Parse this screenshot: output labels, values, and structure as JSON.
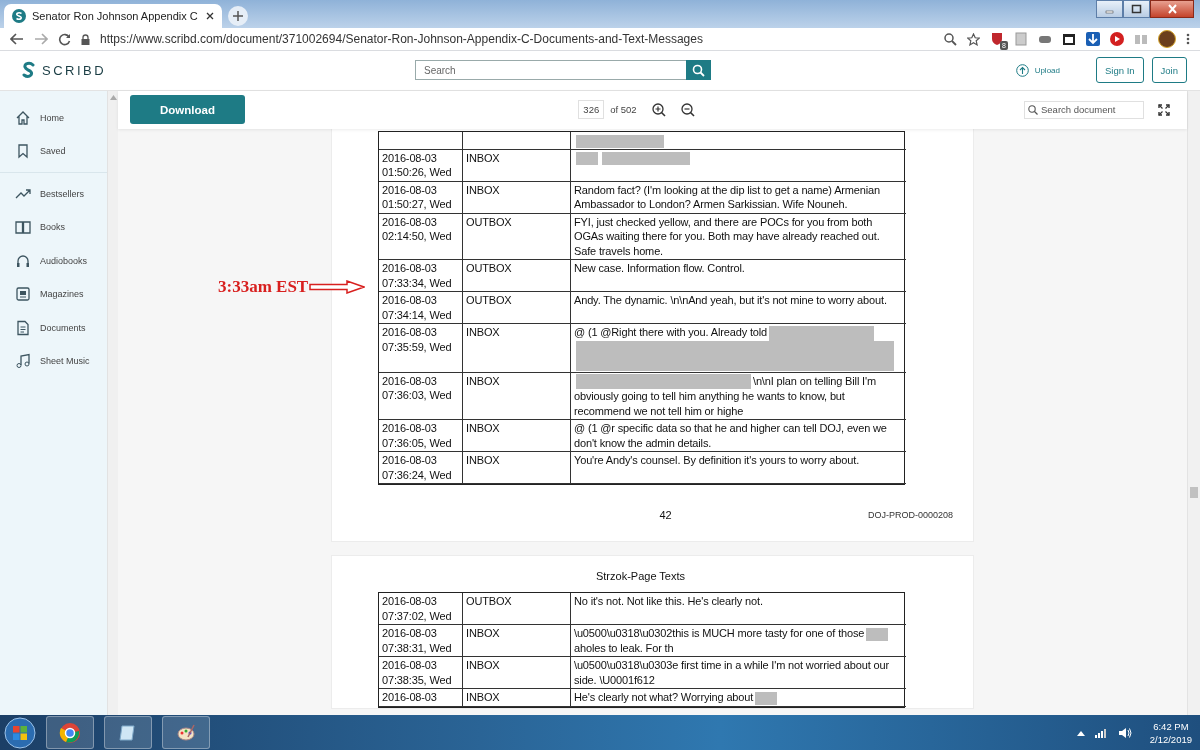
{
  "browser": {
    "tab": {
      "title": "Senator Ron Johnson Appendix C",
      "selected": true
    },
    "url": "https://www.scribd.com/document/371002694/Senator-Ron-Johnson-Appendix-C-Documents-and-Text-Messages",
    "extension_badge": "8"
  },
  "header": {
    "logo": "SCRIBD",
    "search_placeholder": "Search",
    "upload": "Upload",
    "sign_in": "Sign In",
    "join": "Join"
  },
  "sidebar": {
    "sections": [
      {
        "items": [
          {
            "label": "Home"
          },
          {
            "label": "Saved"
          }
        ]
      },
      {
        "items": [
          {
            "label": "Bestsellers"
          },
          {
            "label": "Books"
          },
          {
            "label": "Audiobooks"
          },
          {
            "label": "Magazines"
          },
          {
            "label": "Documents"
          },
          {
            "label": "Sheet Music"
          }
        ]
      }
    ]
  },
  "toolbar": {
    "download": "Download",
    "page": "326",
    "page_total": "of 502",
    "search_placeholder": "Search document"
  },
  "annotation": {
    "text": "3:33am EST"
  },
  "pages": [
    {
      "rows": [
        {
          "segments": [
            {
              "kind": "redaction_long"
            }
          ]
        },
        {
          "date": "2016-08-03",
          "time": "01:50:26, Wed",
          "folder": "INBOX",
          "segments": [
            {
              "kind": "redaction_short"
            },
            {
              "kind": "redaction_long"
            }
          ]
        },
        {
          "date": "2016-08-03",
          "time": "01:50:27, Wed",
          "folder": "INBOX",
          "segments": [
            {
              "kind": "text",
              "text": "Random fact? (I'm looking at the dip list to get a name) Armenian Ambassador to London? Armen Sarkissian. Wife Nouneh."
            }
          ]
        },
        {
          "date": "2016-08-03",
          "time": "02:14:50, Wed",
          "folder": "OUTBOX",
          "segments": [
            {
              "kind": "text",
              "text": "FYI, just checked yellow, and there are POCs for you from both OGAs waiting there for you. Both may have already reached out. Safe travels home."
            }
          ]
        },
        {
          "date": "2016-08-03",
          "time": "07:33:34, Wed",
          "folder": "OUTBOX",
          "segments": [
            {
              "kind": "text",
              "text": "New case. Information flow. Control."
            }
          ]
        },
        {
          "date": "2016-08-03",
          "time": "07:34:14, Wed",
          "folder": "OUTBOX",
          "segments": [
            {
              "kind": "text",
              "text": "Andy. The dynamic. \\n\\nAnd yeah, but it's not mine to worry about."
            }
          ]
        },
        {
          "date": "2016-08-03",
          "time": "07:35:59, Wed",
          "folder": "INBOX",
          "segments": [
            {
              "kind": "text",
              "text": "@ (1 @Right there with you. Already told"
            },
            {
              "kind": "redaction_fill"
            },
            {
              "kind": "redaction_block"
            }
          ]
        },
        {
          "date": "2016-08-03",
          "time": "07:36:03, Wed",
          "folder": "INBOX",
          "segments": [
            {
              "kind": "redaction_wide"
            },
            {
              "kind": "text",
              "text": "\\n\\nI plan on telling Bill I'm"
            },
            {
              "kind": "text",
              "text": "obviously going to tell him anything he wants to know, but recommend we not tell him or highe"
            }
          ]
        },
        {
          "date": "2016-08-03",
          "time": "07:36:05, Wed",
          "folder": "INBOX",
          "segments": [
            {
              "kind": "text",
              "text": "@ (1 @r specific data so that he and higher can tell DOJ, even we don't know the admin details."
            }
          ]
        },
        {
          "date": "2016-08-03",
          "time": "07:36:24, Wed",
          "folder": "INBOX",
          "segments": [
            {
              "kind": "text",
              "text": "You're Andy's counsel. By definition it's yours to worry about."
            }
          ]
        }
      ],
      "page_number": "42",
      "bates": "DOJ-PROD-0000208"
    },
    {
      "title": "Strzok-Page Texts",
      "rows": [
        {
          "date": "2016-08-03",
          "time": "07:37:02, Wed",
          "folder": "OUTBOX",
          "segments": [
            {
              "kind": "text",
              "text": "No it's not. Not like this. He's clearly not."
            }
          ]
        },
        {
          "date": "2016-08-03",
          "time": "07:38:31, Wed",
          "folder": "INBOX",
          "segments": [
            {
              "kind": "text",
              "text": "\\u0500\\u0318\\u0302this is MUCH more tasty for one of those"
            },
            {
              "kind": "redaction_short"
            },
            {
              "kind": "text",
              "text": "aholes to leak. For th"
            }
          ]
        },
        {
          "date": "2016-08-03",
          "time": "07:38:35, Wed",
          "folder": "INBOX",
          "segments": [
            {
              "kind": "text",
              "text": "\\u0500\\u0318\\u0303e first time in a while I'm not worried about our side. \\U0001f612"
            }
          ]
        },
        {
          "date": "2016-08-03",
          "folder": "INBOX",
          "segments": [
            {
              "kind": "text",
              "text": "He's clearly not what? Worrying about"
            },
            {
              "kind": "redaction_short"
            }
          ]
        }
      ]
    }
  ],
  "taskbar": {
    "time": "6:42 PM",
    "date": "2/12/2019"
  }
}
